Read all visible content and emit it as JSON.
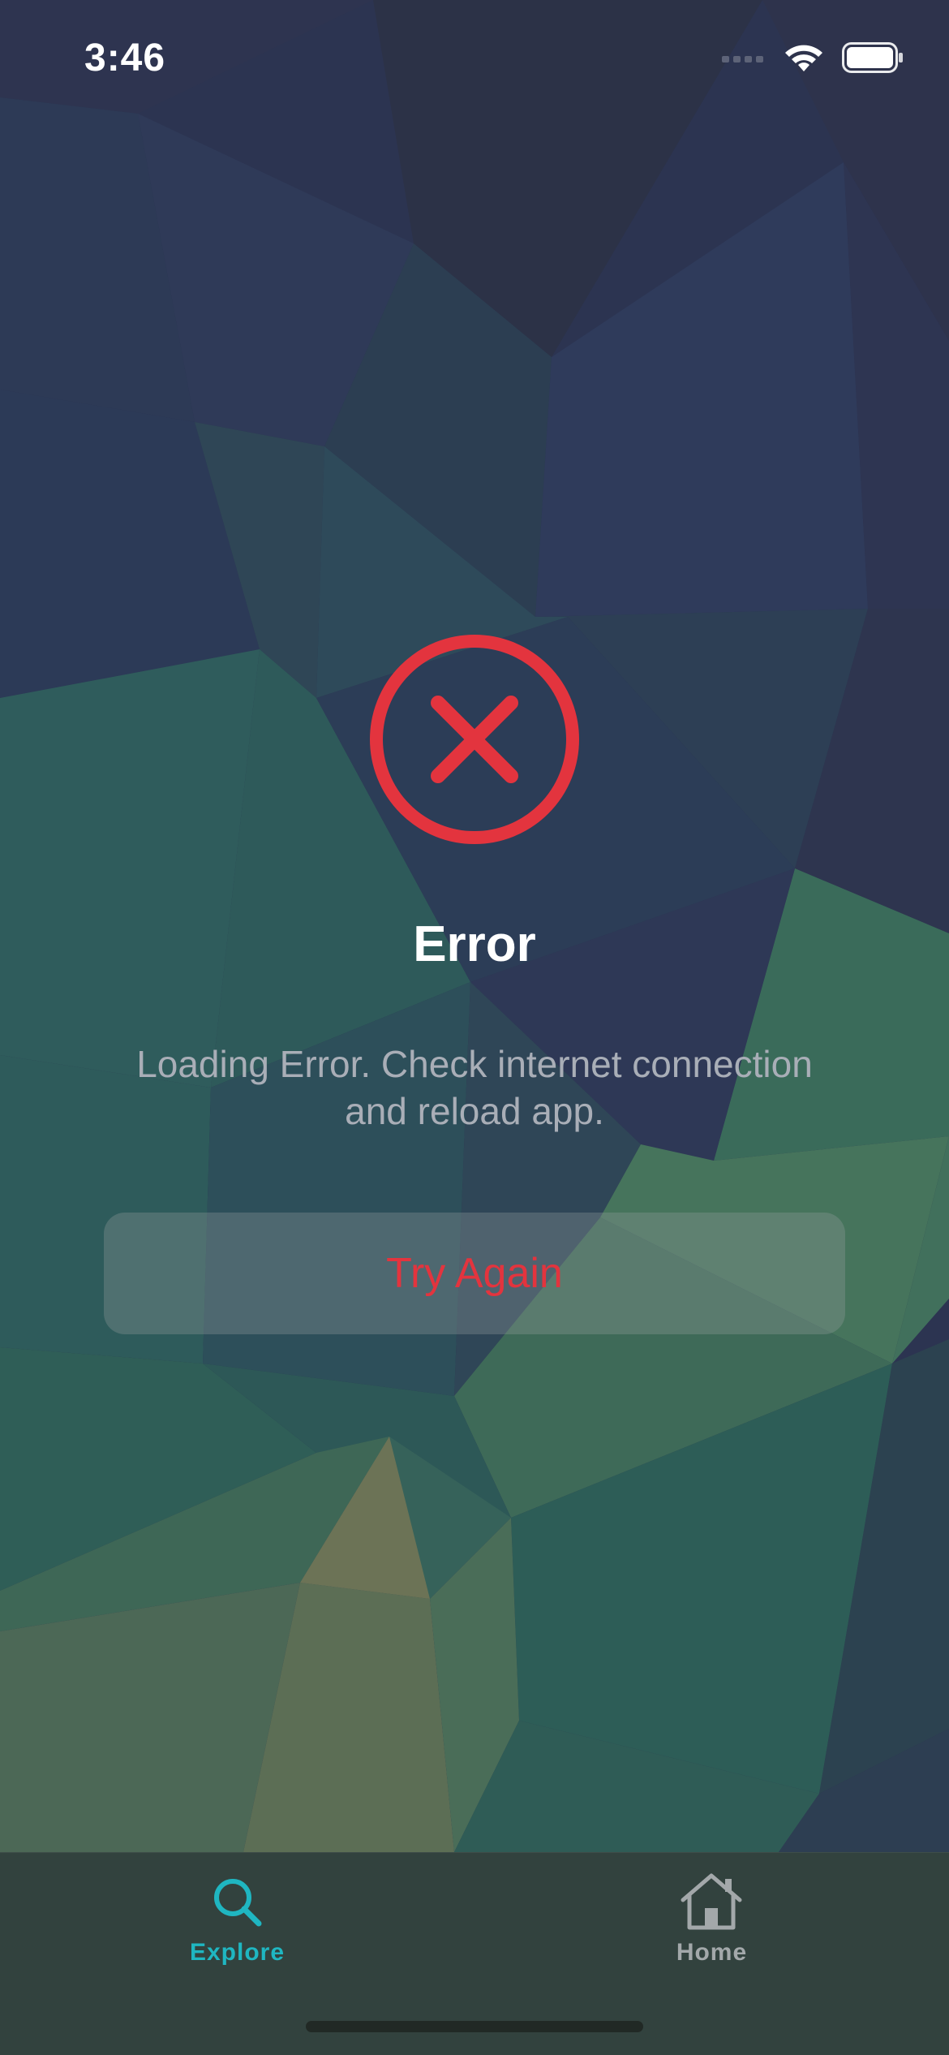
{
  "status_bar": {
    "time": "3:46"
  },
  "error": {
    "icon": "x-circle-icon",
    "icon_color": "#e3343e",
    "title": "Error",
    "message_line1": "Loading Error. Check internet connection",
    "message_line2": "and reload app.",
    "retry_label": "Try Again"
  },
  "tab_bar": {
    "tabs": [
      {
        "label": "Explore",
        "icon": "search-icon",
        "selected": true,
        "color": "#1fb6c1"
      },
      {
        "label": "Home",
        "icon": "home-icon",
        "selected": false,
        "color": "#a3a8aa"
      }
    ]
  }
}
